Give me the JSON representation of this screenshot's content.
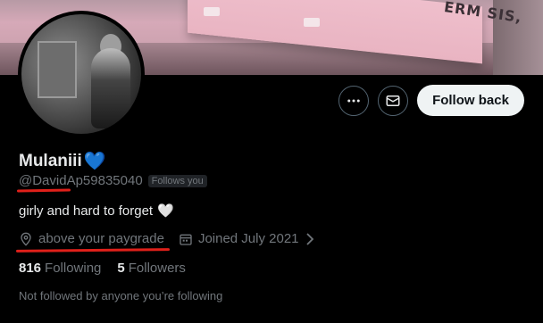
{
  "banner": {
    "billboard_text": "ERM SIS,"
  },
  "profile": {
    "display_name": "Mulaniii",
    "name_emoji": "💙",
    "handle": "@DavidAp59835040",
    "follows_you_badge": "Follows you",
    "bio": "girly and hard to forget",
    "bio_emoji": "🤍",
    "location": "above your paygrade",
    "joined": "Joined July 2021",
    "following_count": "816",
    "following_label": "Following",
    "followers_count": "5",
    "followers_label": "Followers",
    "not_followed_note": "Not followed by anyone you’re following"
  },
  "actions": {
    "more_icon": "more-horizontal-icon",
    "message_icon": "envelope-icon",
    "follow_back_label": "Follow back"
  },
  "colors": {
    "background": "#000000",
    "text_primary": "#e7e9ea",
    "text_secondary": "#71767b",
    "annotation_red": "#e0201a",
    "button_bg": "#eff3f4"
  }
}
